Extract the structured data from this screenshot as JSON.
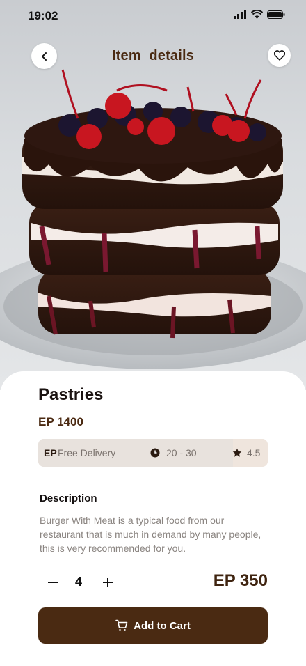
{
  "status_bar": {
    "time": "19:02"
  },
  "header": {
    "title": "Item  details",
    "back_icon": "chevron-left-icon",
    "favorite_icon": "heart-icon"
  },
  "product": {
    "image": "chocolate-cherry-layer-cake",
    "name": "Pastries",
    "price": "EP 1400"
  },
  "info": {
    "currency_mark": "EP",
    "delivery": "Free Delivery",
    "time": "20 - 30",
    "rating": "4.5"
  },
  "description": {
    "title": "Description",
    "body": "Burger With Meat is a typical food from our restaurant that is much in demand by many people, this is very recommended for you."
  },
  "order": {
    "quantity": "4",
    "total": "EP 350"
  },
  "cart_button": {
    "label": "Add to Cart",
    "icon": "cart-icon"
  },
  "colors": {
    "brand": "#4a2a12",
    "info_bg": "#ece7e2",
    "text_muted": "#8a8480"
  }
}
